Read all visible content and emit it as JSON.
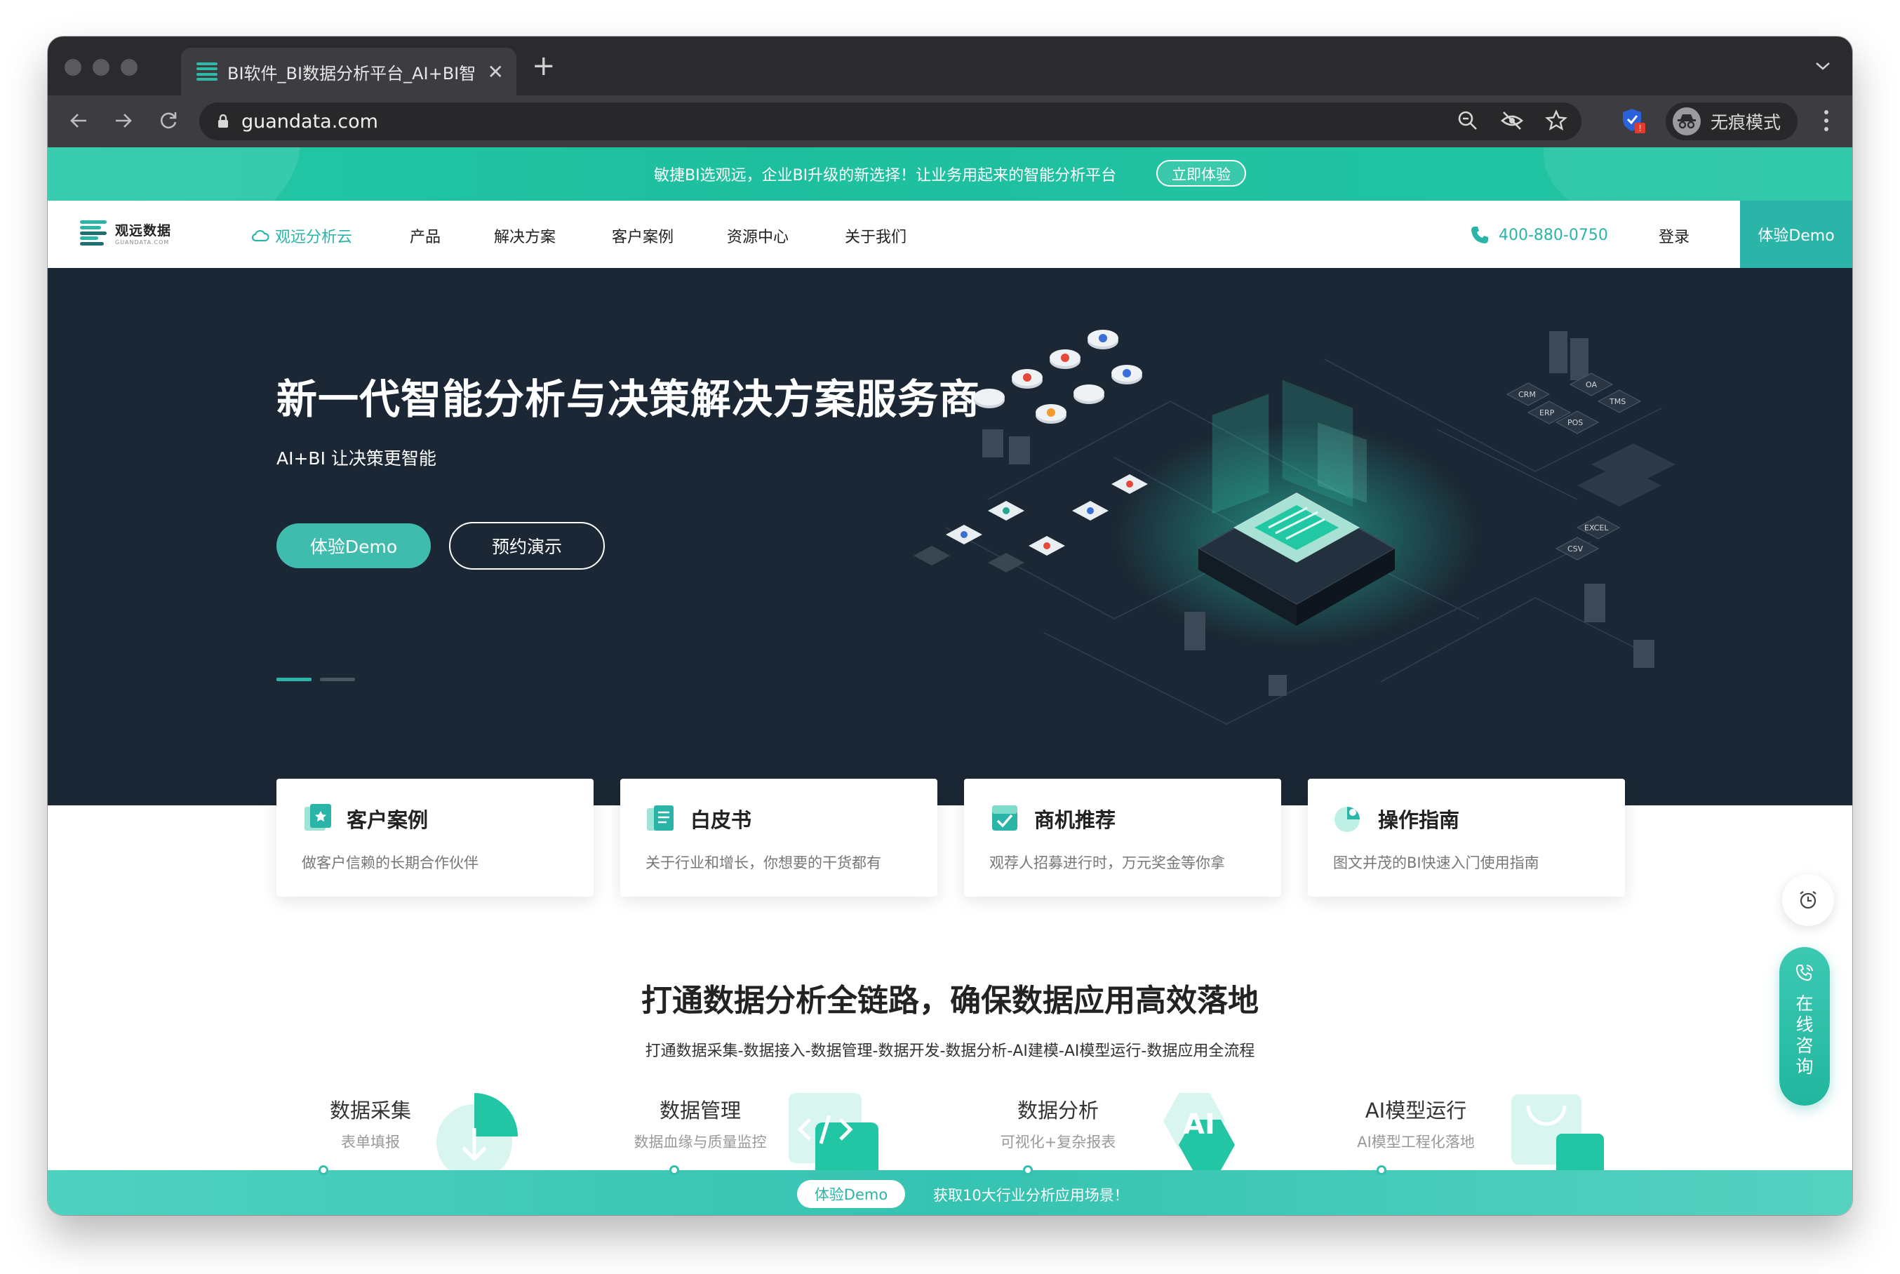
{
  "browser": {
    "tab_title": "BI软件_BI数据分析平台_AI+BI智",
    "url": "guandata.com",
    "incognito_label": "无痕模式",
    "colors": {
      "tabbar": "#2b2b2f",
      "toolbar": "#3c3c41",
      "omnibox": "#28282b"
    }
  },
  "promo": {
    "text": "敏捷BI选观远，企业BI升级的新选择！让业务用起来的智能分析平台",
    "button": "立即体验"
  },
  "header": {
    "logo_name": "观远数据",
    "logo_sub": "GUANDATA.COM",
    "nav": [
      {
        "label": "观远分析云",
        "active": true
      },
      {
        "label": "产品"
      },
      {
        "label": "解决方案"
      },
      {
        "label": "客户案例"
      },
      {
        "label": "资源中心"
      },
      {
        "label": "关于我们"
      }
    ],
    "phone": "400-880-0750",
    "login": "登录",
    "demo": "体验Demo"
  },
  "hero": {
    "title": "新一代智能分析与决策解决方案服务商",
    "subtitle": "AI+BI 让决策更智能",
    "primary_button": "体验Demo",
    "secondary_button": "预约演示",
    "carousel_active_index": 0,
    "illustration_labels": [
      "CRM",
      "ERP",
      "OA",
      "POS",
      "TMS",
      "EXCEL",
      "CSV"
    ]
  },
  "cards": [
    {
      "title": "客户案例",
      "desc": "做客户信赖的长期合作伙伴",
      "icon": "case-icon"
    },
    {
      "title": "白皮书",
      "desc": "关于行业和增长，你想要的干货都有",
      "icon": "book-icon"
    },
    {
      "title": "商机推荐",
      "desc": "观荐人招募进行时，万元奖金等你拿",
      "icon": "check-icon"
    },
    {
      "title": "操作指南",
      "desc": "图文并茂的BI快速入门使用指南",
      "icon": "guide-icon"
    }
  ],
  "section": {
    "title": "打通数据分析全链路，确保数据应用高效落地",
    "subtitle": "打通数据采集-数据接入-数据管理-数据开发-数据分析-AI建模-AI模型运行-数据应用全流程"
  },
  "features": [
    {
      "title": "数据采集",
      "desc": "表单填报"
    },
    {
      "title": "数据管理",
      "desc": "数据血缘与质量监控"
    },
    {
      "title": "数据分析",
      "desc": "可视化+复杂报表"
    },
    {
      "title": "AI模型运行",
      "desc": "AI模型工程化落地"
    }
  ],
  "bottom_bar": {
    "button": "体验Demo",
    "message": "获取10大行业分析应用场景！"
  },
  "floating": {
    "consult_label": "在线咨询"
  },
  "accent_color": "#2bb5a9"
}
